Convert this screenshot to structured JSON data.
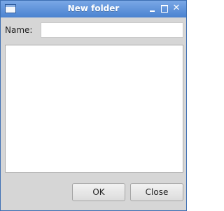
{
  "window": {
    "title": "New folder",
    "controls": {
      "minimize": "",
      "maximize": "",
      "close": "✕"
    }
  },
  "form": {
    "name_label": "Name:",
    "name_value": "",
    "name_placeholder": ""
  },
  "buttons": {
    "ok_label": "OK",
    "close_label": "Close"
  },
  "colors": {
    "titlebar": "#4a82d0",
    "window_bg": "#d6d6d6",
    "field_bg": "#ffffff"
  }
}
